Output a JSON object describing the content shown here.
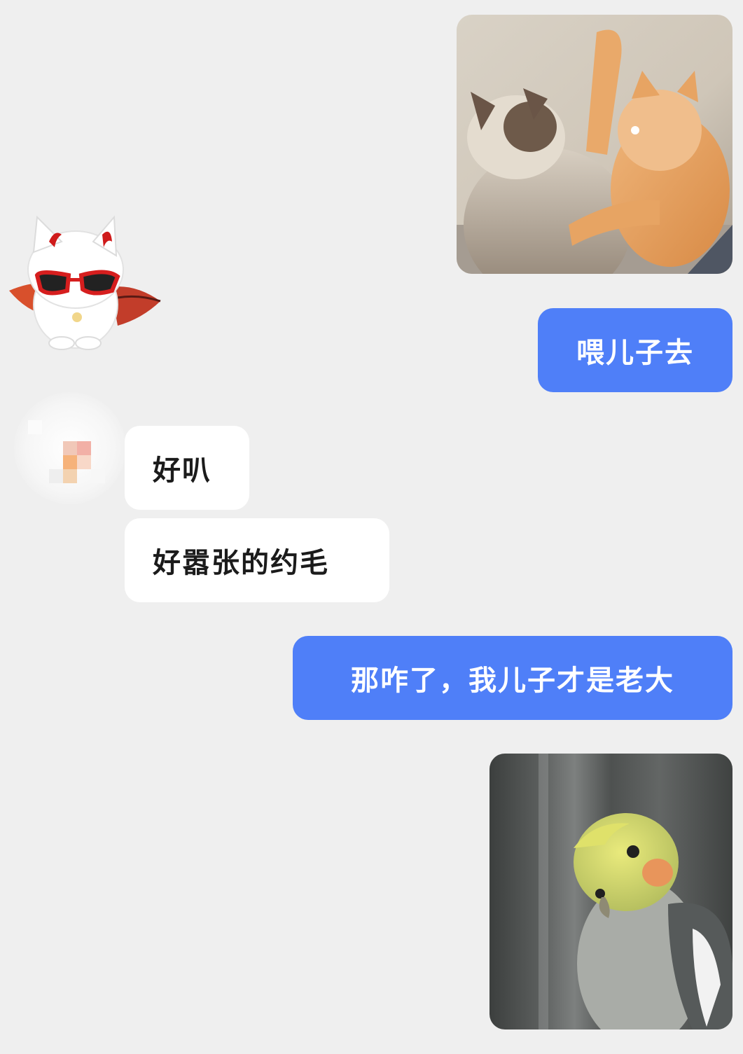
{
  "chat": {
    "messages": [
      {
        "side": "outgoing",
        "kind": "image",
        "depicts": "cat-fight-image"
      },
      {
        "side": "incoming",
        "kind": "sticker",
        "depicts": "devil-cat-sticker"
      },
      {
        "side": "outgoing",
        "kind": "text",
        "text": "喂儿子去"
      },
      {
        "side": "incoming",
        "kind": "text",
        "text": "好叭"
      },
      {
        "side": "incoming",
        "kind": "text",
        "text": "好嚣张的约毛"
      },
      {
        "side": "outgoing",
        "kind": "text",
        "text": "那咋了，我儿子才是老大"
      },
      {
        "side": "outgoing",
        "kind": "image",
        "depicts": "cockatiel-image"
      }
    ]
  },
  "colors": {
    "background": "#efefef",
    "outgoing_bubble": "#4f7ff8",
    "incoming_bubble": "#ffffff",
    "incoming_text": "#1b1b1b"
  }
}
